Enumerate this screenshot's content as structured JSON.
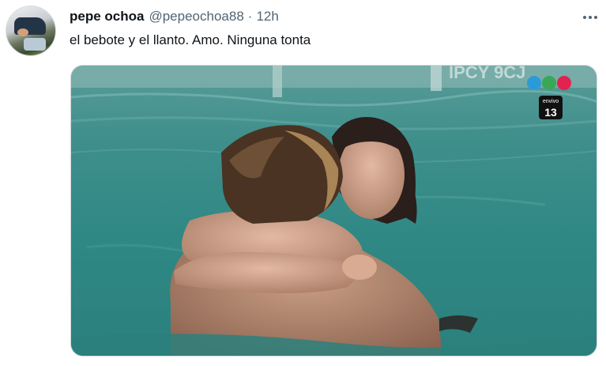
{
  "tweet": {
    "author": {
      "display_name": "pepe ochoa",
      "handle": "@pepeochoa88",
      "avatar_icon": "profile-avatar"
    },
    "separator": "·",
    "timestamp": "12h",
    "text": "el bebote y el llanto. Amo. Ninguna tonta",
    "more_icon": "more-horizontal-icon",
    "media": {
      "type": "photo",
      "overlay_text": "IPCY 9CJ",
      "channel_logo_label": "envivo",
      "channel_logo_number": "13",
      "logo_colors": [
        "#2b9bd8",
        "#3aa757",
        "#e2224f"
      ]
    }
  }
}
